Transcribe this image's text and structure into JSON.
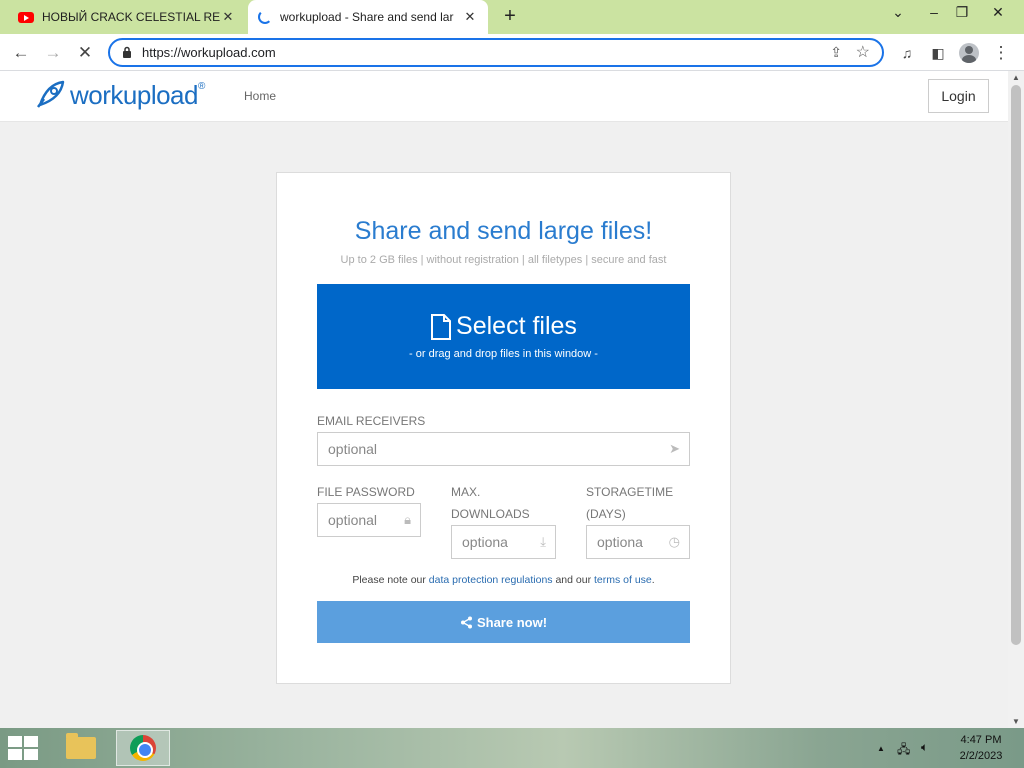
{
  "browser": {
    "tabs": [
      {
        "title": "НОВЫЙ CRACK CELESTIAL RECO",
        "icon": "youtube-icon"
      },
      {
        "title": "workupload - Share and send lar",
        "icon": "loading-spinner-icon"
      }
    ],
    "url": "https://workupload.com"
  },
  "site": {
    "logo_text": "workupload",
    "logo_mark": "®",
    "nav": {
      "home": "Home"
    },
    "login": "Login"
  },
  "upload": {
    "title": "Share and send large files!",
    "subtitle": "Up to 2 GB files | without registration | all filetypes | secure and fast",
    "select_files": "Select files",
    "drag_hint": "- or drag and drop files in this window -",
    "email_label": "EMAIL RECEIVERS",
    "email_placeholder": "optional",
    "password_label": "FILE PASSWORD",
    "password_placeholder": "optional",
    "downloads_label_1": "MAX.",
    "downloads_label_2": "DOWNLOADS",
    "downloads_placeholder": "optional",
    "storage_label_1": "STORAGETIME",
    "storage_label_2": "(DAYS)",
    "storage_placeholder": "optional",
    "note_prefix": "Please note our ",
    "note_link1": "data protection regulations",
    "note_middle": " and our ",
    "note_link2": "terms of use",
    "note_suffix": ".",
    "share_button": "Share now!"
  },
  "taskbar": {
    "time": "4:47 PM",
    "date": "2/2/2023"
  },
  "colors": {
    "brand_blue": "#0067c9",
    "title_blue": "#2a7ccf",
    "share_button": "#5b9fde",
    "tab_strip": "#cbe3a1"
  }
}
